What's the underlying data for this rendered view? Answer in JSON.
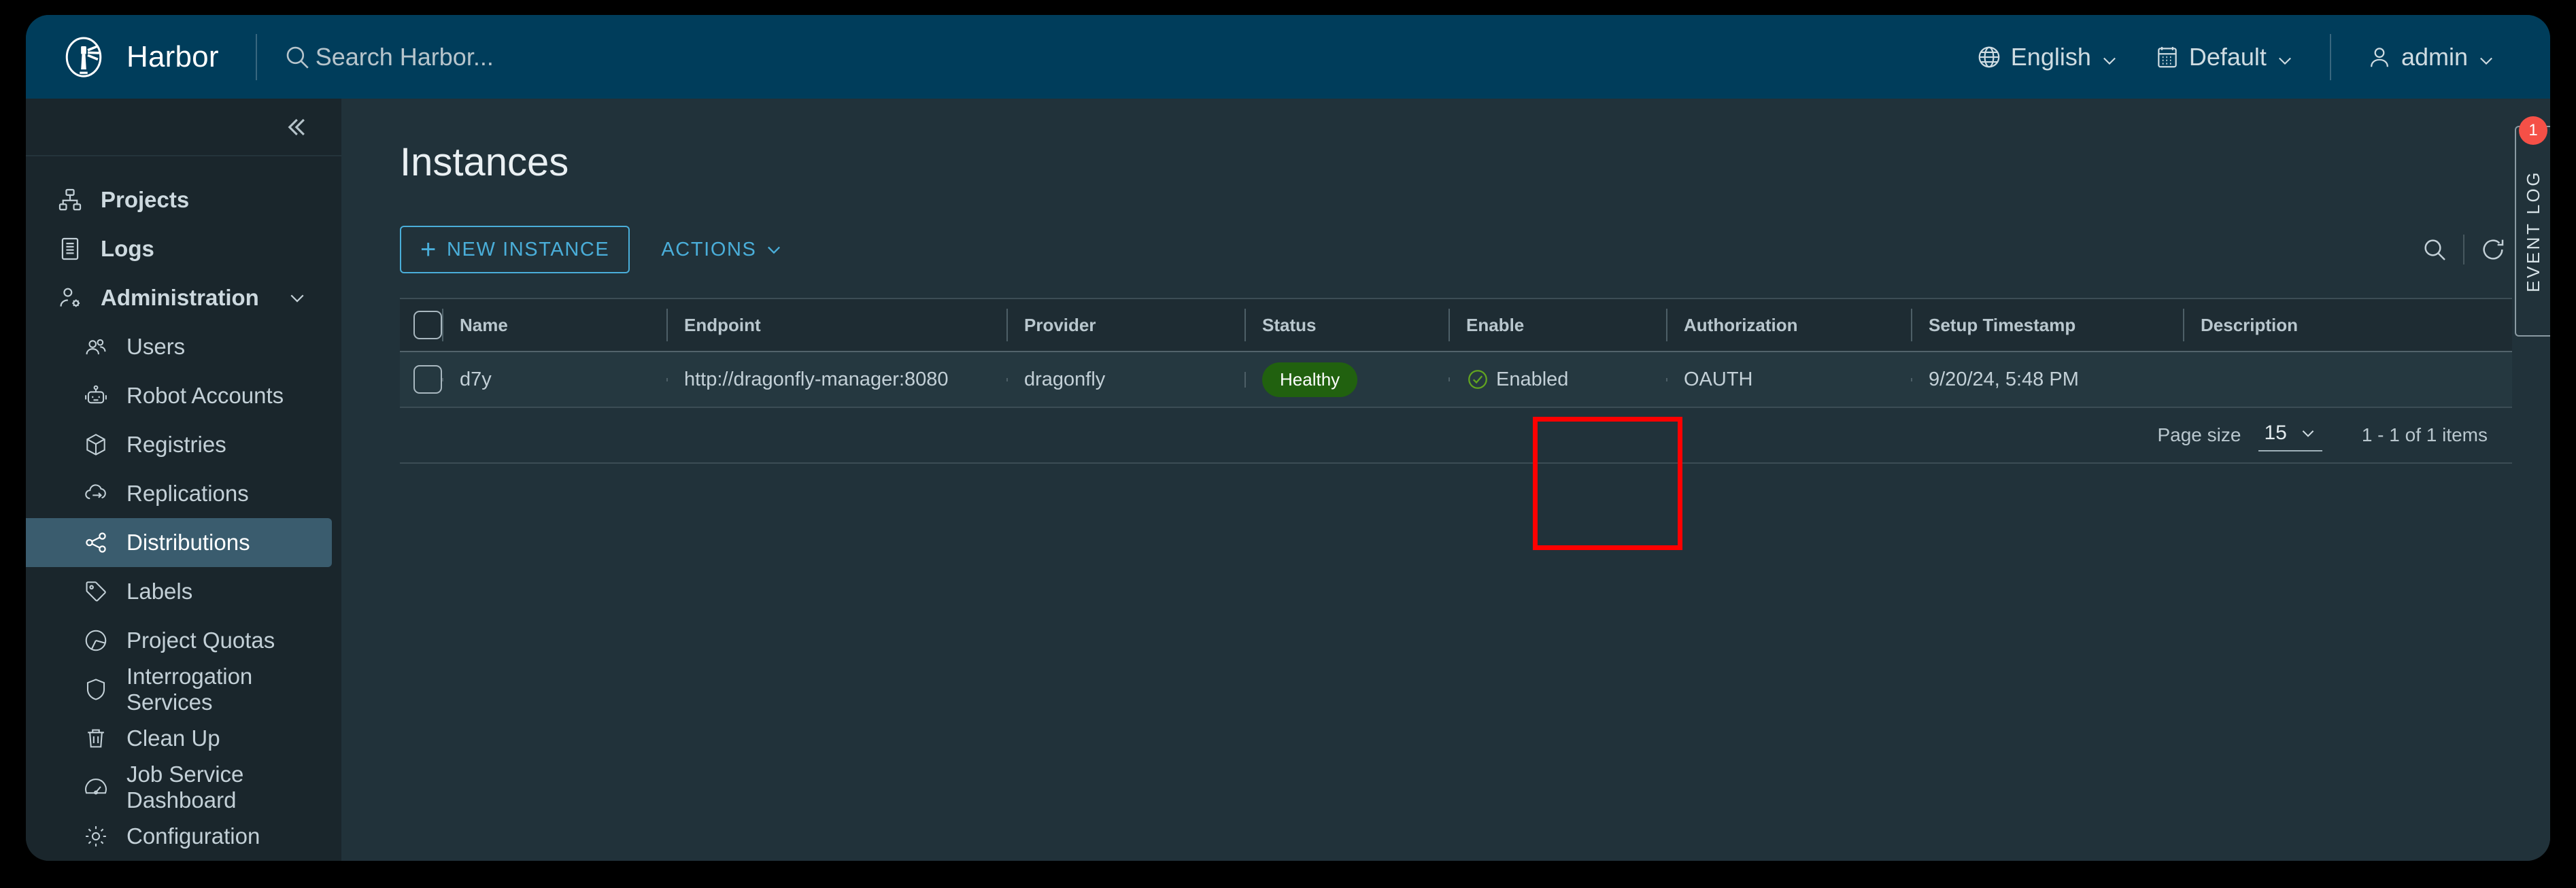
{
  "header": {
    "brand": "Harbor",
    "logo_icon": "harbor-lighthouse-icon",
    "search": {
      "icon": "search-icon",
      "placeholder": "Search Harbor...",
      "value": ""
    },
    "language": {
      "icon": "globe-icon",
      "label": "English",
      "caret": "chevron-down-icon"
    },
    "theme": {
      "icon": "calendar-icon",
      "label": "Default",
      "caret": "chevron-down-icon"
    },
    "user": {
      "icon": "user-icon",
      "label": "admin",
      "caret": "chevron-down-icon"
    }
  },
  "sidebar": {
    "collapse_icon": "double-chevron-left-icon",
    "items": [
      {
        "label": "Projects",
        "icon": "projects-icon",
        "level": "top"
      },
      {
        "label": "Logs",
        "icon": "logs-icon",
        "level": "top"
      },
      {
        "label": "Administration",
        "icon": "administration-icon",
        "level": "top",
        "expand_icon": "chevron-down-icon"
      },
      {
        "label": "Users",
        "icon": "users-icon",
        "level": "sub"
      },
      {
        "label": "Robot Accounts",
        "icon": "robot-icon",
        "level": "sub"
      },
      {
        "label": "Registries",
        "icon": "registry-box-icon",
        "level": "sub"
      },
      {
        "label": "Replications",
        "icon": "replication-cloud-icon",
        "level": "sub"
      },
      {
        "label": "Distributions",
        "icon": "distributions-share-icon",
        "level": "sub",
        "active": true
      },
      {
        "label": "Labels",
        "icon": "label-tag-icon",
        "level": "sub"
      },
      {
        "label": "Project Quotas",
        "icon": "pie-chart-icon",
        "level": "sub"
      },
      {
        "label": "Interrogation Services",
        "icon": "shield-icon",
        "level": "sub"
      },
      {
        "label": "Clean Up",
        "icon": "trash-icon",
        "level": "sub"
      },
      {
        "label": "Job Service Dashboard",
        "icon": "dashboard-gauge-icon",
        "level": "sub"
      },
      {
        "label": "Configuration",
        "icon": "gear-icon",
        "level": "sub"
      }
    ]
  },
  "main": {
    "page_title": "Instances",
    "toolbar": {
      "new_instance_label": "NEW INSTANCE",
      "new_instance_plus": "+",
      "actions_label": "ACTIONS",
      "actions_caret": "chevron-down-icon",
      "search_icon": "search-icon",
      "refresh_icon": "refresh-icon"
    },
    "table": {
      "columns": [
        "Name",
        "Endpoint",
        "Provider",
        "Status",
        "Enable",
        "Authorization",
        "Setup Timestamp",
        "Description"
      ],
      "rows": [
        {
          "name": "d7y",
          "endpoint": "http://dragonfly-manager:8080",
          "provider": "dragonfly",
          "status": "Healthy",
          "enable": "Enabled",
          "enable_icon": "check-circle-icon",
          "authorization": "OAUTH",
          "setup_timestamp": "9/20/24, 5:48 PM",
          "description": ""
        }
      ]
    },
    "footer": {
      "page_size_label": "Page size",
      "page_size_value": "15",
      "page_size_caret": "chevron-down-icon",
      "items_range": "1 - 1 of 1 items"
    }
  },
  "event_log": {
    "label": "EVENT LOG",
    "badge_count": "1"
  },
  "colors": {
    "header_bg": "#003d5b",
    "sidebar_bg": "#1a262c",
    "main_bg": "#21323a",
    "accent": "#4aaed9",
    "status_healthy": "#21610f",
    "enabled_check": "#62a420",
    "badge_red": "#f55047",
    "annotation": "#ff0000"
  }
}
